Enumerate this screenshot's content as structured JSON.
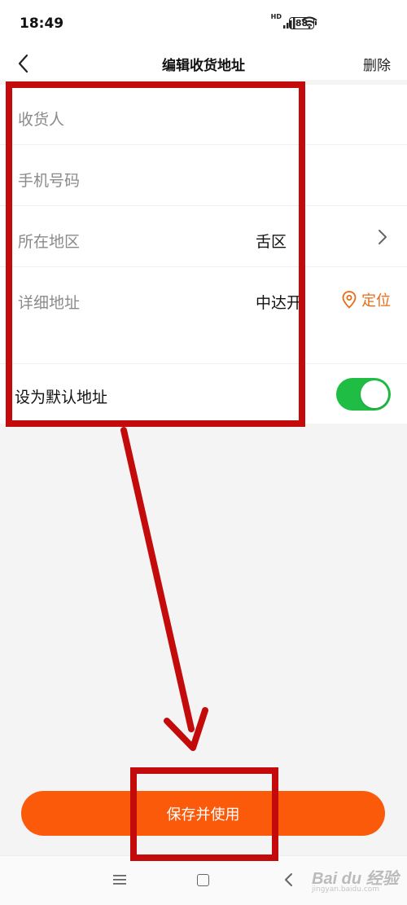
{
  "status_bar": {
    "time": "18:49",
    "network_label": "HD",
    "battery_level": "88",
    "icons": [
      "signal-icon",
      "wifi-icon",
      "battery-icon"
    ]
  },
  "header": {
    "title": "编辑收货地址",
    "delete_label": "删除",
    "back_icon": "back-arrow-icon"
  },
  "form": {
    "recipient_label": "收货人",
    "phone_label": "手机号码",
    "region_label": "所在地区",
    "region_value": "舌区",
    "detail_label": "详细地址",
    "detail_value": "中达开",
    "locate_label": "定位",
    "default_label": "设为默认地址",
    "default_on": true
  },
  "actions": {
    "save_label": "保存并使用"
  },
  "system_nav": {
    "icons": [
      "menu-icon",
      "home-icon",
      "back-icon"
    ]
  },
  "watermark": {
    "text": "Bai du 经验",
    "url": "jingyan.baidu.com"
  },
  "colors": {
    "accent": "#fb5a0b",
    "toggle_on": "#1fbd44",
    "annotation": "#c40b0b",
    "locate": "#e86b17"
  }
}
